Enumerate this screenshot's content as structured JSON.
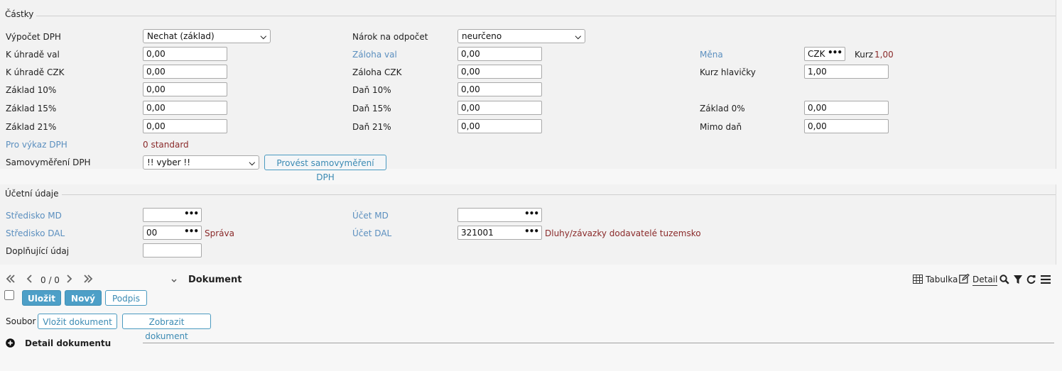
{
  "castky": {
    "legend": "Částky",
    "vypocet_dph_label": "Výpočet DPH",
    "vypocet_dph_value": "Nechat (základ)",
    "narok_label": "Nárok na odpočet",
    "narok_value": "neurčeno",
    "k_uhrade_val_label": "K úhradě val",
    "k_uhrade_val_value": "0,00",
    "zaloha_val_label": "Záloha val",
    "zaloha_val_value": "0,00",
    "mena_label": "Měna",
    "mena_value": "CZK",
    "kurz_label": "Kurz",
    "kurz_value": "1,00",
    "k_uhrade_czk_label": "K úhradě CZK",
    "k_uhrade_czk_value": "0,00",
    "zaloha_czk_label": "Záloha CZK",
    "zaloha_czk_value": "0,00",
    "kurz_hlavicky_label": "Kurz hlavičky",
    "kurz_hlavicky_value": "1,00",
    "zaklad10_label": "Základ 10%",
    "zaklad10_value": "0,00",
    "dan10_label": "Daň 10%",
    "dan10_value": "0,00",
    "zaklad15_label": "Základ 15%",
    "zaklad15_value": "0,00",
    "dan15_label": "Daň 15%",
    "dan15_value": "0,00",
    "zaklad0_label": "Základ 0%",
    "zaklad0_value": "0,00",
    "zaklad21_label": "Základ 21%",
    "zaklad21_value": "0,00",
    "dan21_label": "Daň 21%",
    "dan21_value": "0,00",
    "mimo_dan_label": "Mimo daň",
    "mimo_dan_value": "0,00",
    "pro_vykaz_label": "Pro výkaz DPH",
    "pro_vykaz_value": "0 standard",
    "samovymereni_label": "Samovyměření DPH",
    "samovymereni_value": "!! vyber !!",
    "samovymereni_button": "Provést samovyměření DPH"
  },
  "ucetni": {
    "legend": "Účetní údaje",
    "stredisko_md_label": "Středisko MD",
    "stredisko_md_value": "",
    "ucet_md_label": "Účet MD",
    "ucet_md_value": "",
    "stredisko_dal_label": "Středisko DAL",
    "stredisko_dal_value": "00",
    "stredisko_dal_desc": "Správa",
    "ucet_dal_label": "Účet DAL",
    "ucet_dal_value": "321001",
    "ucet_dal_desc": "Dluhy/závazky dodavatelé tuzemsko",
    "doplnujici_label": "Doplňující údaj",
    "doplnujici_value": ""
  },
  "dokument": {
    "pager": "0 / 0",
    "title": "Dokument",
    "tabulka_label": "Tabulka",
    "detail_label": "Detail",
    "ulozit_label": "Uložit",
    "novy_label": "Nový",
    "podpis_label": "Podpis",
    "soubor_label": "Soubor",
    "vlozit_label": "Vložit dokument",
    "zobrazit_label": "Zobrazit dokument",
    "detail_dokumentu_label": "Detail dokumentu"
  },
  "icons": [
    "first-page-icon",
    "prev-page-icon",
    "next-page-icon",
    "last-page-icon",
    "collapse-chevron-icon",
    "table-icon",
    "edit-icon",
    "search-icon",
    "filter-icon",
    "refresh-icon",
    "menu-icon",
    "plus-circle-icon"
  ]
}
